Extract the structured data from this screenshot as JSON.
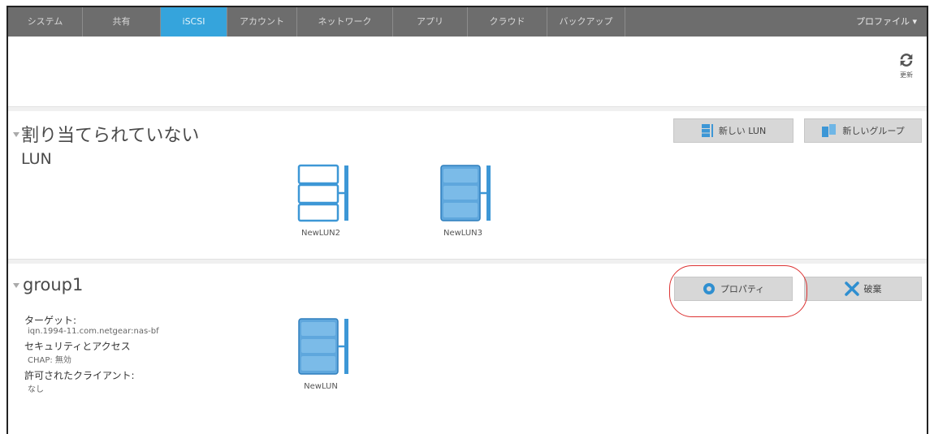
{
  "nav": {
    "tabs": [
      {
        "label": "システム",
        "active": false
      },
      {
        "label": "共有",
        "active": false
      },
      {
        "label": "iSCSI",
        "active": true
      },
      {
        "label": "アカウント",
        "active": false
      },
      {
        "label": "ネットワーク",
        "active": false
      },
      {
        "label": "アプリ",
        "active": false
      },
      {
        "label": "クラウド",
        "active": false
      },
      {
        "label": "バックアップ",
        "active": false
      }
    ],
    "profile_label": "プロファイル ▾"
  },
  "toolbar": {
    "refresh_label": "更新",
    "refresh_icon": "refresh-icon"
  },
  "unassigned": {
    "title_line1": "割り当てられていない",
    "title_line2": "LUN",
    "new_lun_label": "新しい LUN",
    "new_group_label": "新しいグループ",
    "luns": [
      {
        "name": "NewLUN2",
        "style": "outline"
      },
      {
        "name": "NewLUN3",
        "style": "filled"
      }
    ]
  },
  "group": {
    "title": "group1",
    "properties_label": "プロパティ",
    "delete_label": "破棄",
    "target_heading": "ターゲット:",
    "target_value": "iqn.1994-11.com.netgear:nas-bf",
    "security_heading": "セキュリティとアクセス",
    "security_value": "CHAP: 無効",
    "clients_heading": "許可されたクライアント:",
    "clients_value": "なし",
    "luns": [
      {
        "name": "NewLUN",
        "style": "filled"
      }
    ]
  },
  "colors": {
    "accent": "#35a4dc",
    "nav_bg": "#6d6d6d",
    "highlight": "#dd3333",
    "delete_icon": "#2f8fd0"
  }
}
